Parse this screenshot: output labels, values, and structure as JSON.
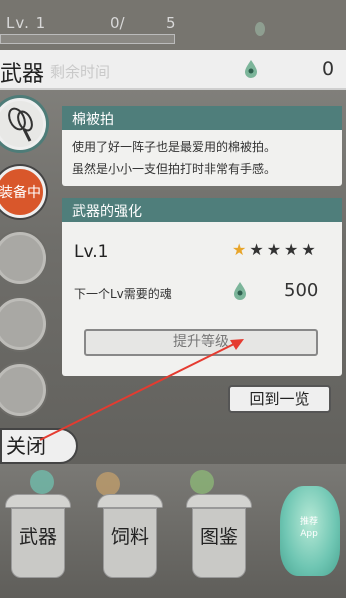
{
  "status": {
    "level_label": "Lv. 1",
    "progress": "0/",
    "max": "5"
  },
  "header": {
    "title": "武器",
    "ghost_text": "剩余时间",
    "soul_count": "0"
  },
  "sidebar": {
    "equip_label": "装备中"
  },
  "item": {
    "name": "棉被拍",
    "description_line1": "使用了好一阵子也是最爱用的棉被拍。",
    "description_line2": "虽然是小小一支但拍打时非常有手感。"
  },
  "enhance": {
    "title": "武器的强化",
    "level": "Lv.1",
    "stars_total": 5,
    "stars_filled": 1,
    "need_label": "下一个Lv需要的魂",
    "need_value": "500",
    "upgrade_label": "提升等级"
  },
  "buttons": {
    "back_label": "回到一览",
    "close_label": "关闭"
  },
  "bottom_nav": {
    "items": [
      {
        "label": "武器"
      },
      {
        "label": "饲料"
      },
      {
        "label": "图鉴"
      }
    ],
    "app_label_line1": "推荐",
    "app_label_line2": "App"
  },
  "colors": {
    "accent": "#4f7e7b",
    "equip_badge": "#d9572b",
    "star_on": "#e8a52a",
    "arrow": "#e53b30"
  },
  "icons": [
    "soul-drop-icon",
    "racket-icon",
    "star-icon",
    "arrow-annotation"
  ]
}
